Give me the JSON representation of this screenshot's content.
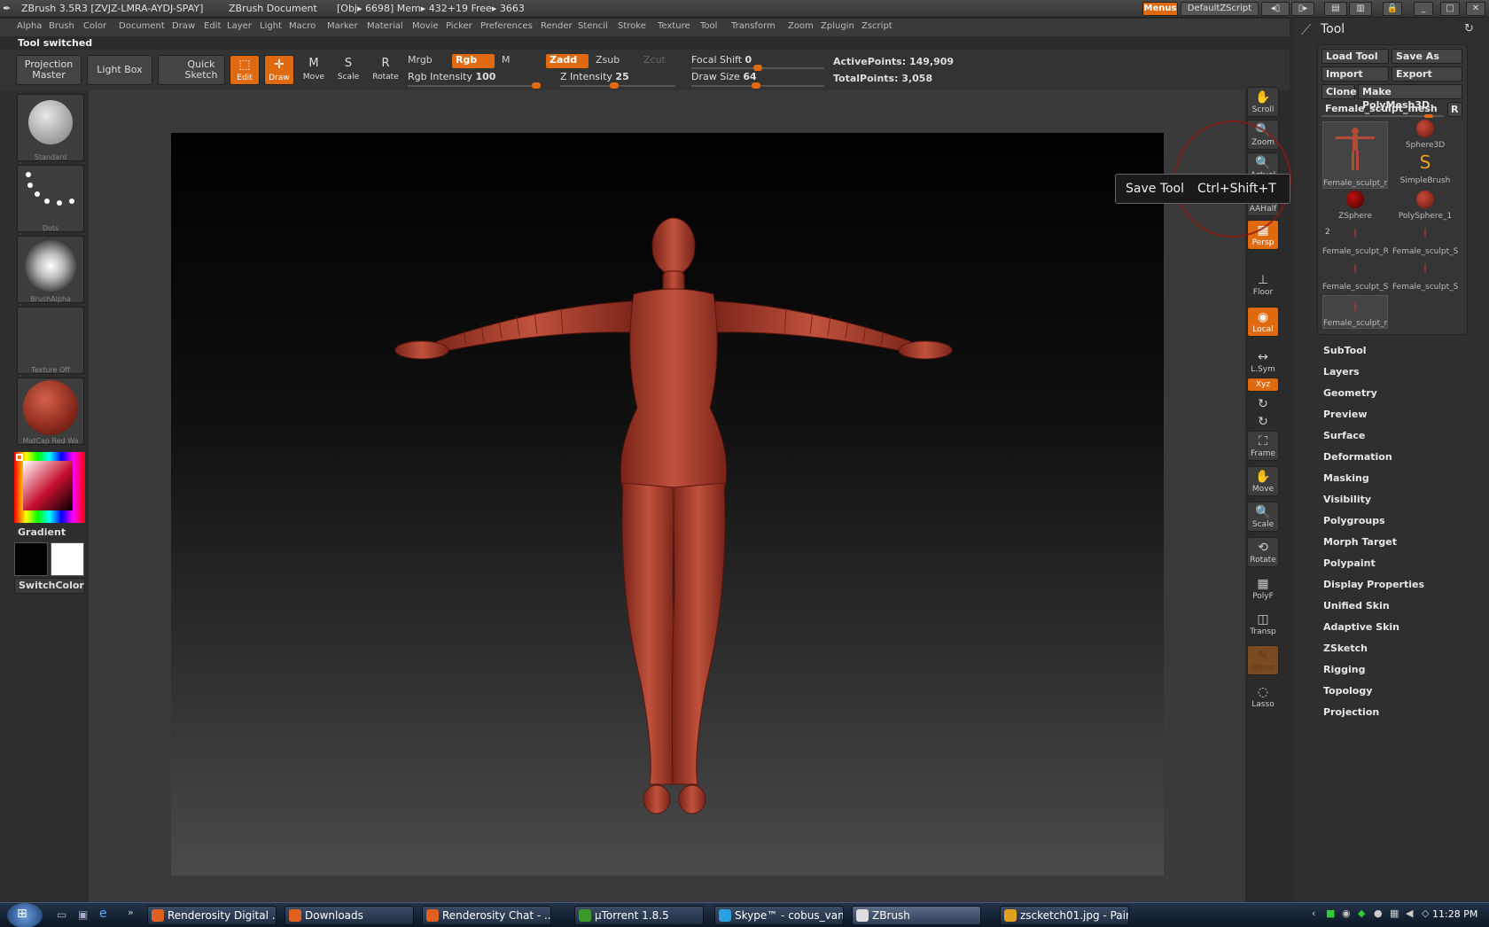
{
  "titlebar": {
    "app": "ZBrush 3.5R3 [ZVJZ-LMRA-AYDJ-SPAY]",
    "document": "ZBrush Document",
    "stats": "[Obj▸ 6698] Mem▸ 432+19 Free▸ 3663",
    "menus_button": "Menus",
    "script_button": "DefaultZScript"
  },
  "menubar": [
    "Alpha",
    "Brush",
    "Color",
    "Document",
    "Draw",
    "Edit",
    "Layer",
    "Light",
    "Macro",
    "Marker",
    "Material",
    "Movie",
    "Picker",
    "Preferences",
    "Render",
    "Stencil",
    "Stroke",
    "Texture",
    "Tool",
    "Transform",
    "Zoom",
    "Zplugin",
    "Zscript"
  ],
  "status_text": "Tool switched",
  "shelf": {
    "projection_master": "Projection Master",
    "light_box": "Light Box",
    "quick_sketch": "Quick Sketch",
    "edit": "Edit",
    "draw": "Draw",
    "move": "Move",
    "scale": "Scale",
    "rotate": "Rotate",
    "mrgb": "Mrgb",
    "rgb": "Rgb",
    "m": "M",
    "zadd": "Zadd",
    "zsub": "Zsub",
    "zcut": "Zcut",
    "rgb_intensity_label": "Rgb Intensity",
    "rgb_intensity": 100,
    "z_intensity_label": "Z Intensity",
    "z_intensity": 25,
    "focal_shift_label": "Focal Shift",
    "focal_shift": 0,
    "draw_size_label": "Draw Size",
    "draw_size": 64,
    "active_points": "ActivePoints: 149,909",
    "total_points": "TotalPoints: 3,058"
  },
  "left": {
    "brush": "Standard",
    "stroke": "Dots",
    "alpha": "BrushAlpha",
    "texture": "Texture Off",
    "material": "MatCap Red Wa",
    "gradient": "Gradient",
    "switch_color": "SwitchColor"
  },
  "rightshelf": [
    "Scroll",
    "Zoom",
    "Actual",
    "AAHalf",
    "Persp",
    "Floor",
    "Local",
    "L.Sym",
    "Xyz",
    "",
    "",
    "Frame",
    "Move",
    "Scale",
    "Rotate",
    "PolyF",
    "Transp",
    "Ghost",
    "Lasso"
  ],
  "tooltip": {
    "label": "Save Tool",
    "shortcut": "Ctrl+Shift+T"
  },
  "tool": {
    "title": "Tool",
    "load_tool": "Load Tool",
    "save_as": "Save As",
    "import": "Import",
    "export": "Export",
    "clone": "Clone",
    "make_polymesh": "Make PolyMesh3D",
    "current_tool": "Female_sculpt_mesh",
    "r_button": "R",
    "items": [
      "Female_sculpt_m",
      "Sphere3D",
      "SimpleBrush",
      "ZSphere",
      "PolySphere_1",
      "Female_sculpt_Re",
      "Female_sculpt_Sk",
      "Female_sculpt_Sk",
      "Female_sculpt_Sk",
      "Female_sculpt_m"
    ],
    "item_count_badge": "2",
    "sections": [
      "SubTool",
      "Layers",
      "Geometry",
      "Preview",
      "Surface",
      "Deformation",
      "Masking",
      "Visibility",
      "Polygroups",
      "Morph Target",
      "Polypaint",
      "Display Properties",
      "Unified Skin",
      "Adaptive Skin",
      "ZSketch",
      "Rigging",
      "Topology",
      "Projection"
    ]
  },
  "taskbar": {
    "tasks": [
      "Renderosity Digital ...",
      "Downloads",
      "Renderosity Chat - ...",
      "µTorrent 1.8.5",
      "Skype™ - cobus_van...",
      "ZBrush",
      "zscketch01.jpg - Paint"
    ],
    "clock": "11:28 PM"
  },
  "colors": {
    "accent": "#e06a10",
    "model": "#b34a38"
  }
}
